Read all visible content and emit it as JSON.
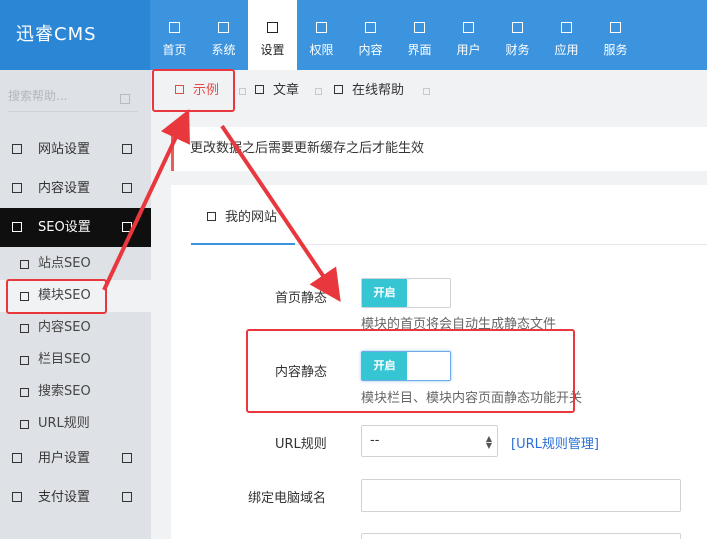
{
  "app": {
    "logo": "迅睿CMS"
  },
  "nav": [
    {
      "label": "首页",
      "icon": "home-icon"
    },
    {
      "label": "系统",
      "icon": "system-icon"
    },
    {
      "label": "设置",
      "icon": "settings-icon",
      "active": true
    },
    {
      "label": "权限",
      "icon": "permission-icon"
    },
    {
      "label": "内容",
      "icon": "content-icon"
    },
    {
      "label": "界面",
      "icon": "interface-icon"
    },
    {
      "label": "用户",
      "icon": "user-icon"
    },
    {
      "label": "财务",
      "icon": "finance-icon"
    },
    {
      "label": "应用",
      "icon": "app-icon"
    },
    {
      "label": "服务",
      "icon": "service-icon"
    }
  ],
  "sidebar": {
    "search_placeholder": "搜索帮助...",
    "items": [
      {
        "label": "网站设置"
      },
      {
        "label": "内容设置"
      },
      {
        "label": "SEO设置",
        "active": true
      },
      {
        "label": "用户设置"
      },
      {
        "label": "支付设置"
      }
    ],
    "sub_items": [
      {
        "label": "站点SEO"
      },
      {
        "label": "模块SEO",
        "current": true
      },
      {
        "label": "内容SEO"
      },
      {
        "label": "栏目SEO"
      },
      {
        "label": "搜索SEO"
      },
      {
        "label": "URL规则"
      }
    ]
  },
  "tabs": [
    {
      "label": "示例",
      "active": true
    },
    {
      "label": "文章"
    },
    {
      "label": "在线帮助"
    }
  ],
  "notice": "更改数据之后需要更新缓存之后才能生效",
  "content_tab": "我的网站",
  "form": {
    "home_static": {
      "label": "首页静态",
      "switch": "开启",
      "help": "模块的首页将会自动生成静态文件"
    },
    "content_static": {
      "label": "内容静态",
      "switch": "开启",
      "help": "模块栏目、模块内容页面静态功能开关"
    },
    "url_rule": {
      "label": "URL规则",
      "value": "--",
      "link": "[URL规则管理]"
    },
    "pc_domain": {
      "label": "绑定电脑域名",
      "value": ""
    }
  },
  "colors": {
    "topbar": "#3c94df",
    "annotation": "#e8383d",
    "switch_on": "#36c6d3"
  }
}
